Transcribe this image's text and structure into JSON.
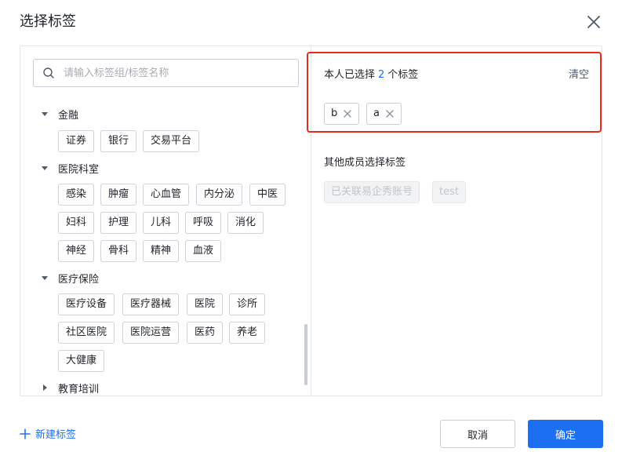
{
  "dialog": {
    "title": "选择标签"
  },
  "search": {
    "placeholder": "请输入标签组/标签名称"
  },
  "tree": [
    {
      "name": "金融",
      "expanded": true,
      "tags": [
        "证券",
        "银行",
        "交易平台"
      ]
    },
    {
      "name": "医院科室",
      "expanded": true,
      "tags": [
        "感染",
        "肿瘤",
        "心血管",
        "内分泌",
        "中医",
        "妇科",
        "护理",
        "儿科",
        "呼吸",
        "消化",
        "神经",
        "骨科",
        "精神",
        "血液"
      ]
    },
    {
      "name": "医疗保险",
      "expanded": true,
      "tags": [
        "医疗设备",
        "医疗器械",
        "医院",
        "诊所",
        "社区医院",
        "医院运营",
        "医药",
        "养老",
        "大健康"
      ]
    },
    {
      "name": "教育培训",
      "expanded": false,
      "tags": []
    }
  ],
  "selected": {
    "prefix": "本人已选择",
    "count": "2",
    "suffix": "个标签",
    "clear_label": "清空",
    "chips": [
      "b",
      "a"
    ]
  },
  "others": {
    "title": "其他成员选择标签",
    "tags": [
      "已关联易企秀账号",
      "test"
    ]
  },
  "footer": {
    "new_tag_label": "新建标签",
    "cancel_label": "取消",
    "ok_label": "确定"
  },
  "colors": {
    "accent": "#1d6ff2",
    "highlight_border": "#e8291c"
  },
  "icons": {
    "close": "close-icon",
    "search": "search-icon",
    "expanded": "caret-down-icon",
    "collapsed": "caret-right-icon",
    "remove": "remove-icon",
    "add": "plus-icon"
  }
}
